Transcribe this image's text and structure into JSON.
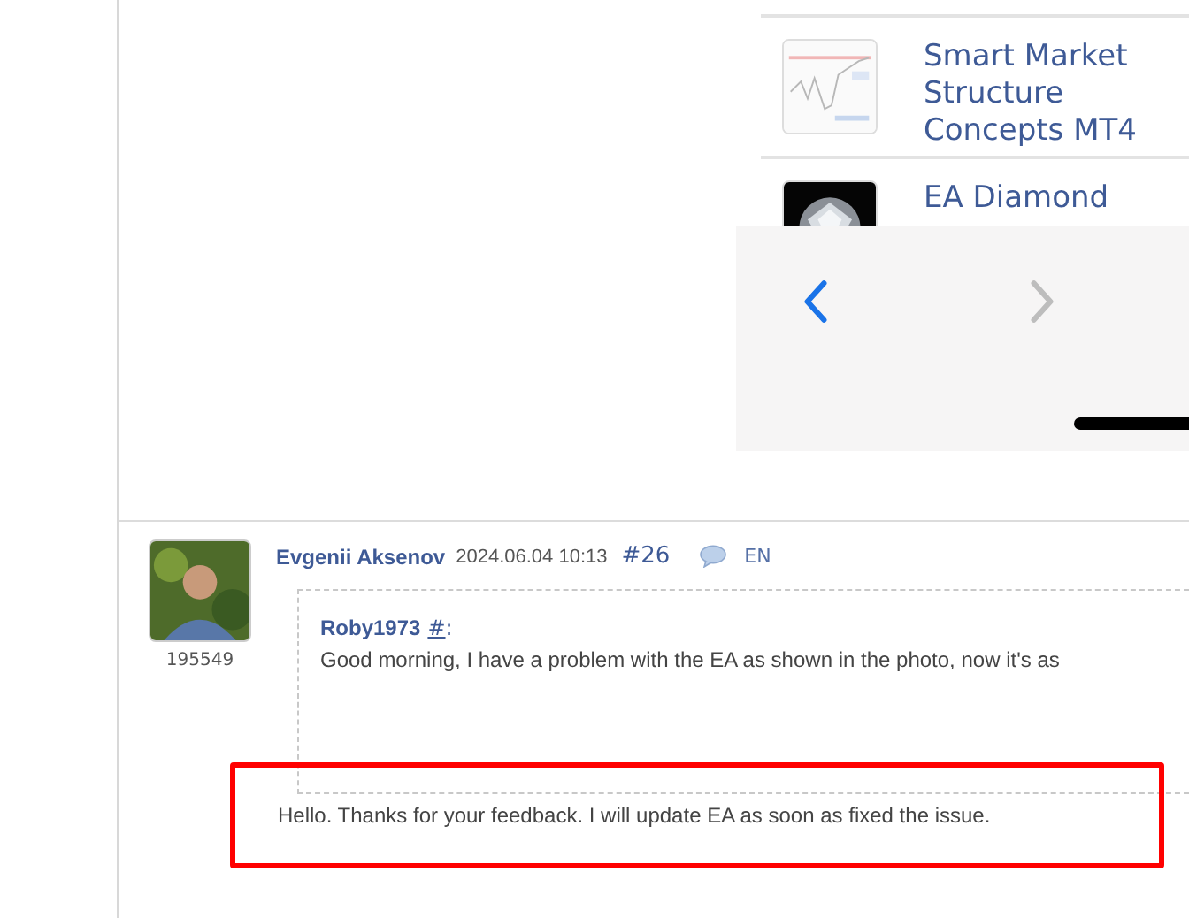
{
  "products": [
    {
      "title": "Smart Market Structure Concepts MT4",
      "kind": "chart"
    },
    {
      "title": "EA Diamond",
      "kind": "gem"
    }
  ],
  "browser_toolbar": {
    "back_enabled": true,
    "forward_enabled": false
  },
  "post": {
    "author": "Evgenii Aksenov",
    "date": "2024.06.04 10:13",
    "number": "#26",
    "language": "EN",
    "user_id": "195549",
    "quote": {
      "author": "Roby1973",
      "link": "#",
      "colon": ":",
      "text": "Good morning, I have a problem with the EA as shown in the photo, now it's as"
    },
    "reply": {
      "text": "Hello. Thanks for your feedback. I will update EA as soon as fixed the issue.",
      "highlighted": true
    }
  }
}
